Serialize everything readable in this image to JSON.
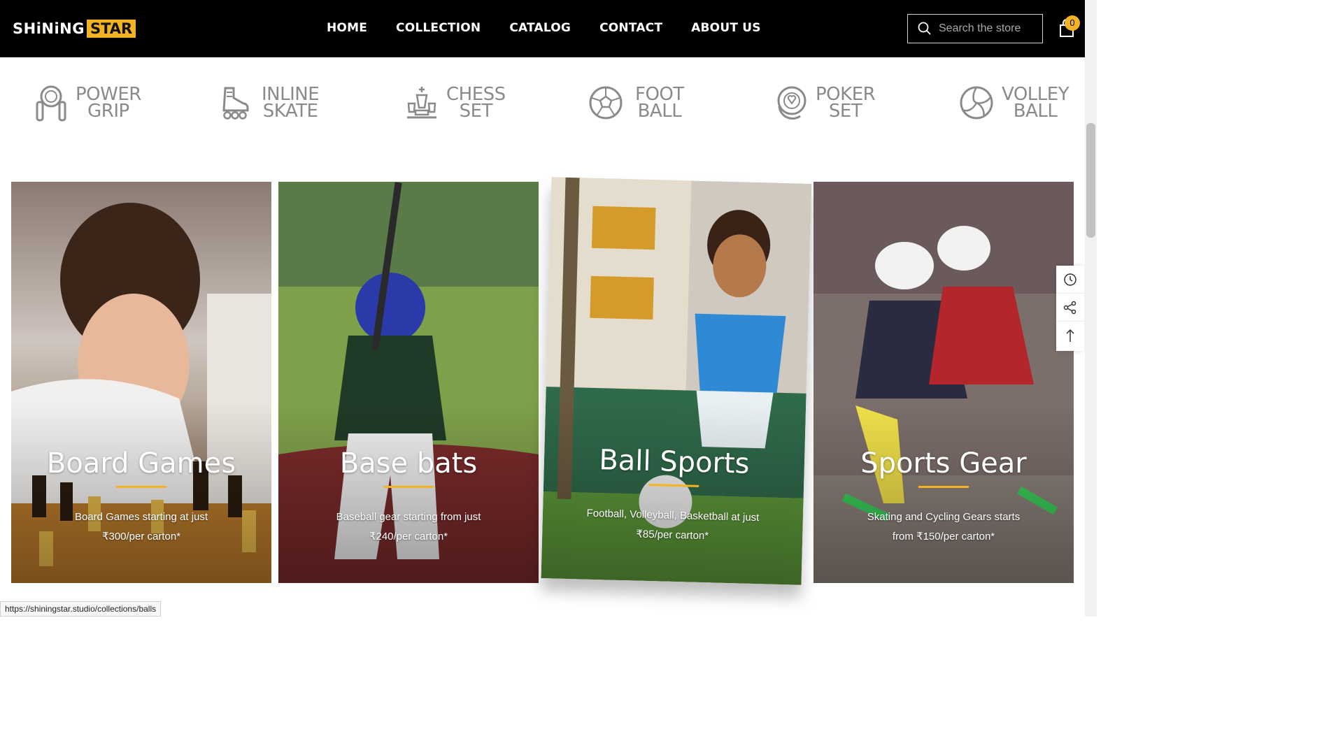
{
  "header": {
    "logo_part1": "SHiNiNG",
    "logo_part2": "STAR",
    "nav": [
      "HOME",
      "COLLECTION",
      "CATALOG",
      "CONTACT",
      "ABOUT US"
    ],
    "search_placeholder": "Search the store",
    "cart_count": "0"
  },
  "categories": [
    {
      "line1": "POWER",
      "line2": "GRIP",
      "icon": "power-grip-icon"
    },
    {
      "line1": "INLINE",
      "line2": "SKATE",
      "icon": "inline-skate-icon"
    },
    {
      "line1": "CHESS",
      "line2": "SET",
      "icon": "chess-icon"
    },
    {
      "line1": "FOOT",
      "line2": "BALL",
      "icon": "football-icon"
    },
    {
      "line1": "POKER",
      "line2": "SET",
      "icon": "poker-chip-icon"
    },
    {
      "line1": "VOLLEY",
      "line2": "BALL",
      "icon": "volleyball-icon"
    }
  ],
  "cards": [
    {
      "title": "Board Games",
      "desc1": "Board Games starting at just",
      "desc2": "₹300/per carton*"
    },
    {
      "title": "Base bats",
      "desc1": "Baseball gear starting from just",
      "desc2": "₹240/per carton*"
    },
    {
      "title": "Ball Sports",
      "desc1": "Football, Volleyball, Basketball at just",
      "desc2": "₹85/per carton*"
    },
    {
      "title": "Sports Gear",
      "desc1": "Skating and Cycling Gears starts",
      "desc2": "from ₹150/per carton*"
    }
  ],
  "status_url": "https://shiningstar.studio/collections/balls",
  "colors": {
    "accent": "#f4b324",
    "header_bg": "#000000",
    "category_text": "#8a8a8a"
  }
}
